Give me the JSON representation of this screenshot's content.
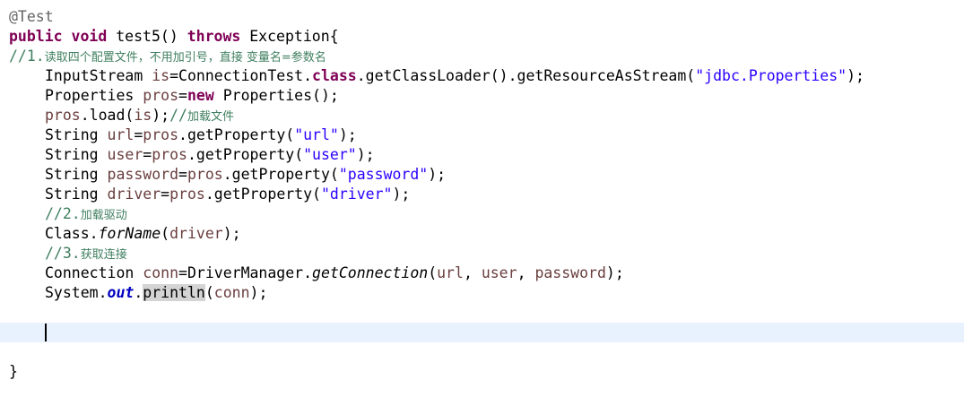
{
  "editor": {
    "theme": {
      "background": "#ffffff",
      "current_line": "#e8f2fe",
      "keyword": "#7f0055",
      "string": "#2a00ff",
      "comment": "#3f7f5f",
      "annotation": "#646464",
      "local_variable": "#6a3e3e",
      "field": "#0000c0",
      "occurrence_highlight": "#d4d4d4"
    },
    "current_line_index": 16,
    "lines": [
      {
        "indent": 0,
        "tokens": [
          {
            "t": "@Test",
            "c": "annotation"
          }
        ]
      },
      {
        "indent": 0,
        "tokens": [
          {
            "t": "public",
            "c": "keyword"
          },
          {
            "t": " "
          },
          {
            "t": "void",
            "c": "keyword"
          },
          {
            "t": " test5() "
          },
          {
            "t": "throws",
            "c": "keyword"
          },
          {
            "t": " Exception{"
          }
        ]
      },
      {
        "indent": 0,
        "tokens": [
          {
            "t": "//1.",
            "c": "comment"
          },
          {
            "t": "读取四个配置文件，不用加引号，直接 变量名=参数名",
            "c": "comment",
            "cjk": true
          }
        ]
      },
      {
        "indent": 1,
        "tokens": [
          {
            "t": "InputStream "
          },
          {
            "t": "is",
            "c": "var"
          },
          {
            "t": "=ConnectionTest."
          },
          {
            "t": "class",
            "c": "keyword"
          },
          {
            "t": ".getClassLoader().getResourceAsStream("
          },
          {
            "t": "\"jdbc.Properties\"",
            "c": "string"
          },
          {
            "t": ");"
          }
        ]
      },
      {
        "indent": 1,
        "tokens": [
          {
            "t": "Properties "
          },
          {
            "t": "pros",
            "c": "var"
          },
          {
            "t": "="
          },
          {
            "t": "new",
            "c": "keyword"
          },
          {
            "t": " Properties();"
          }
        ]
      },
      {
        "indent": 1,
        "tokens": [
          {
            "t": "pros",
            "c": "var"
          },
          {
            "t": ".load("
          },
          {
            "t": "is",
            "c": "var"
          },
          {
            "t": ");"
          },
          {
            "t": "//",
            "c": "comment"
          },
          {
            "t": "加载文件",
            "c": "comment",
            "cjk": true
          }
        ]
      },
      {
        "indent": 1,
        "tokens": [
          {
            "t": "String "
          },
          {
            "t": "url",
            "c": "var"
          },
          {
            "t": "="
          },
          {
            "t": "pros",
            "c": "var"
          },
          {
            "t": ".getProperty("
          },
          {
            "t": "\"url\"",
            "c": "string"
          },
          {
            "t": ");"
          }
        ]
      },
      {
        "indent": 1,
        "tokens": [
          {
            "t": "String "
          },
          {
            "t": "user",
            "c": "var"
          },
          {
            "t": "="
          },
          {
            "t": "pros",
            "c": "var"
          },
          {
            "t": ".getProperty("
          },
          {
            "t": "\"user\"",
            "c": "string"
          },
          {
            "t": ");"
          }
        ]
      },
      {
        "indent": 1,
        "tokens": [
          {
            "t": "String "
          },
          {
            "t": "password",
            "c": "var"
          },
          {
            "t": "="
          },
          {
            "t": "pros",
            "c": "var"
          },
          {
            "t": ".getProperty("
          },
          {
            "t": "\"password\"",
            "c": "string"
          },
          {
            "t": ");"
          }
        ]
      },
      {
        "indent": 1,
        "tokens": [
          {
            "t": "String "
          },
          {
            "t": "driver",
            "c": "var"
          },
          {
            "t": "="
          },
          {
            "t": "pros",
            "c": "var"
          },
          {
            "t": ".getProperty("
          },
          {
            "t": "\"driver\"",
            "c": "string"
          },
          {
            "t": ");"
          }
        ]
      },
      {
        "indent": 1,
        "tokens": [
          {
            "t": "//2.",
            "c": "comment"
          },
          {
            "t": "加载驱动",
            "c": "comment",
            "cjk": true
          }
        ]
      },
      {
        "indent": 1,
        "tokens": [
          {
            "t": "Class."
          },
          {
            "t": "forName",
            "c": "static"
          },
          {
            "t": "("
          },
          {
            "t": "driver",
            "c": "var"
          },
          {
            "t": ");"
          }
        ]
      },
      {
        "indent": 1,
        "tokens": [
          {
            "t": "//3.",
            "c": "comment"
          },
          {
            "t": "获取连接",
            "c": "comment",
            "cjk": true
          }
        ]
      },
      {
        "indent": 1,
        "tokens": [
          {
            "t": "Connection "
          },
          {
            "t": "conn",
            "c": "var"
          },
          {
            "t": "=DriverManager."
          },
          {
            "t": "getConnection",
            "c": "static"
          },
          {
            "t": "("
          },
          {
            "t": "url",
            "c": "var"
          },
          {
            "t": ", "
          },
          {
            "t": "user",
            "c": "var"
          },
          {
            "t": ", "
          },
          {
            "t": "password",
            "c": "var"
          },
          {
            "t": ");"
          }
        ]
      },
      {
        "indent": 1,
        "tokens": [
          {
            "t": "System."
          },
          {
            "t": "out",
            "c": "field"
          },
          {
            "t": "."
          },
          {
            "t": "println",
            "c": "highlight"
          },
          {
            "t": "("
          },
          {
            "t": "conn",
            "c": "var"
          },
          {
            "t": ");"
          }
        ]
      },
      {
        "indent": 1,
        "tokens": []
      },
      {
        "indent": 1,
        "tokens": [],
        "caret": true
      },
      {
        "indent": 1,
        "tokens": []
      },
      {
        "indent": 0,
        "tokens": [
          {
            "t": "}"
          }
        ]
      }
    ]
  }
}
